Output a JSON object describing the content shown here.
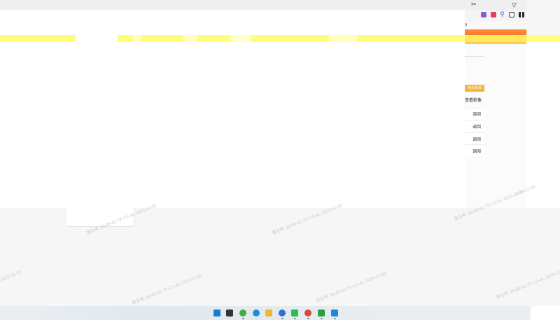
{
  "browser": {
    "filter_glyph": "▽",
    "extensions": [
      {
        "name": "scissors-icon",
        "glyph": "✂",
        "color": "#555555"
      },
      {
        "name": "purple-extension-icon",
        "glyph": "",
        "color": "#8a5cd6"
      },
      {
        "name": "gamepad-icon",
        "glyph": "",
        "color": "#e0405a"
      },
      {
        "name": "search-extension-icon",
        "glyph": "⚲",
        "color": "#2a64d6"
      },
      {
        "name": "window-icon",
        "glyph": "",
        "color": "#444444"
      },
      {
        "name": "grid-icon",
        "glyph": "",
        "color": "#222222"
      }
    ],
    "row_bar_text": "n"
  },
  "right_panel": {
    "tag_label": "待办事项",
    "column_header": "查看影像",
    "rows": [
      {
        "action": "调阅"
      },
      {
        "action": "调阅"
      },
      {
        "action": "调阅"
      },
      {
        "action": "调阅"
      }
    ]
  },
  "watermarks": [
    "医生甲, 89-88-81-7F-C3-46, 2023-12-29",
    "医生甲, 89-88-81-7F-C3-46, 2023-12-29",
    "医生甲, 89-88-81-7F-C3-46, 2023-12-29",
    "医生甲, 89-88-81-7F-C3-46, 2023-12-29",
    "医生甲, 89-88-81-7F-C3-46, 2023-12-29",
    "医生甲, 89-88-81-7F-C3-46, 2023-12-29",
    "2023-12-29",
    "2023-12-29"
  ],
  "taskbar": {
    "apps": [
      {
        "name": "windows-start-icon",
        "color": "#1e79d8"
      },
      {
        "name": "task-view-icon",
        "color": "#333333"
      },
      {
        "name": "app-refresh-icon",
        "color": "#3fae4a"
      },
      {
        "name": "edge-browser-icon",
        "color": "#1c8fd6"
      },
      {
        "name": "file-explorer-icon",
        "color": "#f1b731"
      },
      {
        "name": "chat-icon",
        "color": "#2a74d0"
      },
      {
        "name": "wechat-icon",
        "color": "#2bbd4f"
      },
      {
        "name": "chrome-browser-icon",
        "color": "#e2452f"
      },
      {
        "name": "green-app-icon",
        "color": "#2e9e46"
      },
      {
        "name": "blue-app-icon",
        "color": "#1a89e0"
      }
    ]
  }
}
